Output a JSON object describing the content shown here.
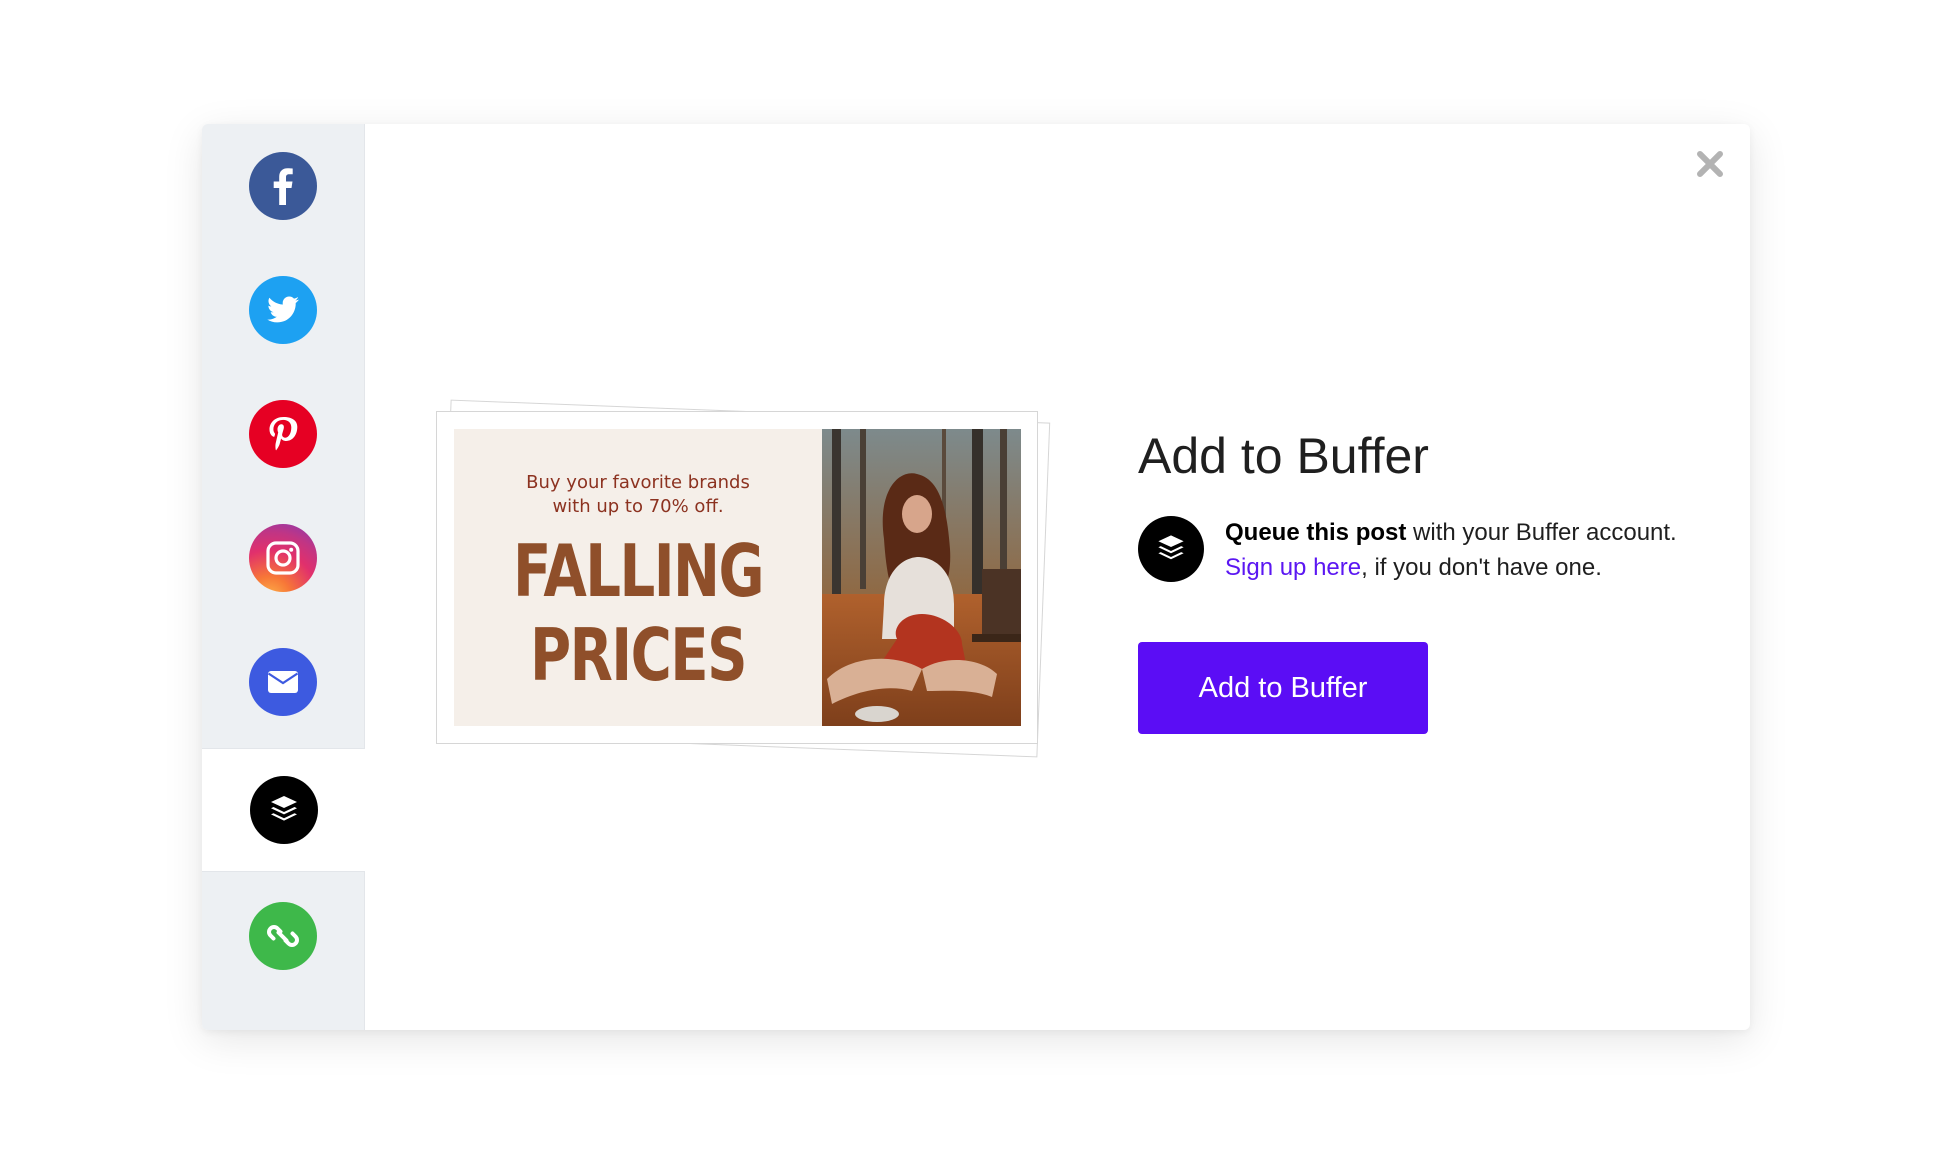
{
  "sidebar": {
    "items": [
      {
        "name": "facebook",
        "icon": "facebook-icon",
        "color": "#3b5998",
        "active": false
      },
      {
        "name": "twitter",
        "icon": "twitter-icon",
        "color": "#1da1f2",
        "active": false
      },
      {
        "name": "pinterest",
        "icon": "pinterest-icon",
        "color": "#e60023",
        "active": false
      },
      {
        "name": "instagram",
        "icon": "instagram-icon",
        "color": "#e1306c",
        "active": false
      },
      {
        "name": "email",
        "icon": "envelope-icon",
        "color": "#3d5ae0",
        "active": false
      },
      {
        "name": "buffer",
        "icon": "buffer-icon",
        "color": "#000000",
        "active": true
      },
      {
        "name": "copy-link",
        "icon": "link-icon",
        "color": "#3eb84a",
        "active": false
      }
    ]
  },
  "close": {
    "icon": "close-icon"
  },
  "preview": {
    "subtitle_line1": "Buy your favorite brands",
    "subtitle_line2": "with up to 70% off.",
    "headline_line1": "FALLING",
    "headline_line2": "PRICES",
    "photo": "woman-sitting-in-autumn-forest-photo"
  },
  "buffer": {
    "title": "Add to Buffer",
    "description_bold": "Queue this post",
    "description_rest": " with your Buffer account.",
    "signup_link": "Sign up here",
    "signup_rest": ", if you don't have one.",
    "button_label": "Add to Buffer"
  },
  "colors": {
    "accent": "#5b0df5",
    "link": "#5b17f2",
    "headline": "#8f4f2a"
  }
}
